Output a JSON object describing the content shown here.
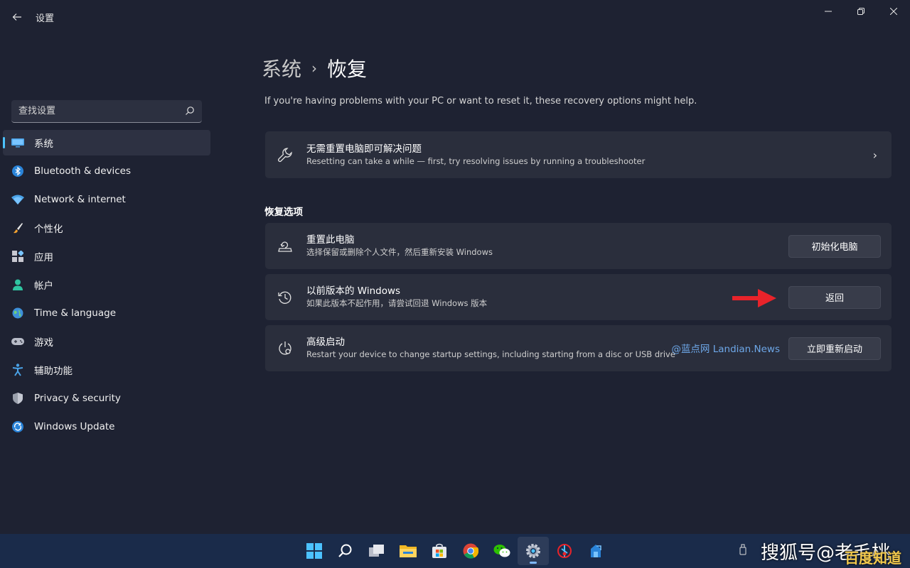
{
  "window": {
    "title": "设置",
    "controls": {
      "minimize": "—",
      "maximize": "❐",
      "close": "✕"
    }
  },
  "sidebar": {
    "search_placeholder": "查找设置",
    "items": [
      {
        "label": "系统",
        "icon": "monitor-icon",
        "active": true
      },
      {
        "label": "Bluetooth & devices",
        "icon": "bluetooth-icon"
      },
      {
        "label": "Network & internet",
        "icon": "wifi-icon"
      },
      {
        "label": "个性化",
        "icon": "brush-icon"
      },
      {
        "label": "应用",
        "icon": "apps-icon"
      },
      {
        "label": "帐户",
        "icon": "account-icon"
      },
      {
        "label": "Time & language",
        "icon": "globe-icon"
      },
      {
        "label": "游戏",
        "icon": "gamepad-icon"
      },
      {
        "label": "辅助功能",
        "icon": "accessibility-icon"
      },
      {
        "label": "Privacy & security",
        "icon": "shield-icon"
      },
      {
        "label": "Windows Update",
        "icon": "update-icon"
      }
    ]
  },
  "main": {
    "breadcrumb": {
      "parent": "系统",
      "separator": "›",
      "current": "恢复"
    },
    "subtitle": "If you're having problems with your PC or want to reset it, these recovery options might help.",
    "troubleshoot_card": {
      "title": "无需重置电脑即可解决问题",
      "desc": "Resetting can take a while — first, try resolving issues by running a troubleshooter",
      "chevron": "›"
    },
    "section_title": "恢复选项",
    "options": [
      {
        "title": "重置此电脑",
        "desc": "选择保留或删除个人文件，然后重新安装 Windows",
        "button": "初始化电脑"
      },
      {
        "title": "以前版本的 Windows",
        "desc": "如果此版本不起作用，请尝试回退 Windows 版本",
        "button": "返回"
      },
      {
        "title": "高级启动",
        "desc": "Restart your device to change startup settings, including starting from a disc or USB drive",
        "button": "立即重新启动"
      }
    ],
    "watermark": "@蓝点网 Landian.News"
  },
  "taskbar": {
    "apps": [
      "start-icon",
      "search-icon",
      "task-view-icon",
      "file-explorer-icon",
      "store-icon",
      "chrome-icon",
      "wechat-icon",
      "settings-icon",
      "app-icon",
      "app2-icon"
    ],
    "active_app": "settings-icon"
  },
  "overlay_watermarks": {
    "sohu": "搜狐号@老毛桃",
    "baidu": "百度知道"
  },
  "colors": {
    "accent": "#4cc2ff",
    "background": "#1e2232",
    "card": "#2a2e3c",
    "arrow": "#e8232a"
  }
}
